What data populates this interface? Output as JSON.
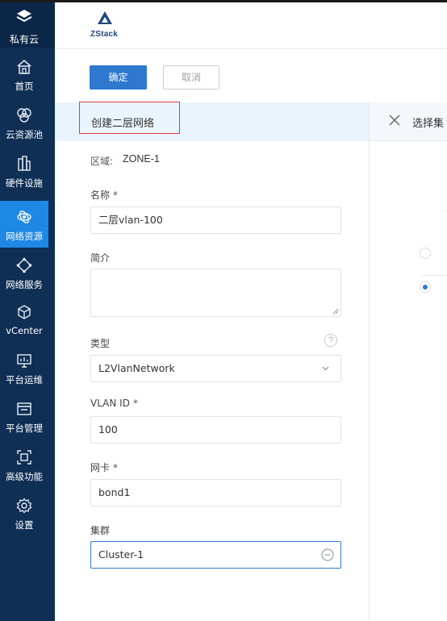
{
  "sidebar": {
    "top_label": "私有云",
    "items": [
      {
        "label": "首页",
        "icon": "home-icon"
      },
      {
        "label": "云资源池",
        "icon": "resource-pool-icon"
      },
      {
        "label": "硬件设施",
        "icon": "hardware-icon"
      },
      {
        "label": "网络资源",
        "icon": "network-resource-icon",
        "active": true
      },
      {
        "label": "网络服务",
        "icon": "network-service-icon"
      },
      {
        "label": "vCenter",
        "icon": "vcenter-icon"
      },
      {
        "label": "平台运维",
        "icon": "ops-icon"
      },
      {
        "label": "平台管理",
        "icon": "platform-admin-icon"
      },
      {
        "label": "高级功能",
        "icon": "advanced-icon"
      },
      {
        "label": "设置",
        "icon": "settings-icon"
      }
    ]
  },
  "brand": {
    "logo_text": "ZStack"
  },
  "toolbar": {
    "ok_label": "确定",
    "cancel_label": "取消"
  },
  "panel": {
    "title": "创建二层网络"
  },
  "right_panel": {
    "title": "选择集"
  },
  "form": {
    "zone_label": "区域:",
    "zone_value": "ZONE-1",
    "name_label": "名称",
    "name_value": "二层vlan-100",
    "desc_label": "简介",
    "desc_value": "",
    "type_label": "类型",
    "type_value": "L2VlanNetwork",
    "vlan_label": "VLAN ID",
    "vlan_value": "100",
    "nic_label": "网卡",
    "nic_value": "bond1",
    "cluster_label": "集群",
    "cluster_value": "Cluster-1",
    "required_mark": "*",
    "help_mark": "?"
  },
  "colors": {
    "sidebar_bg": "#0f2f55",
    "active_nav": "#1e88e5",
    "primary_button": "#2f78cf",
    "highlight_border": "#e23a3a"
  }
}
